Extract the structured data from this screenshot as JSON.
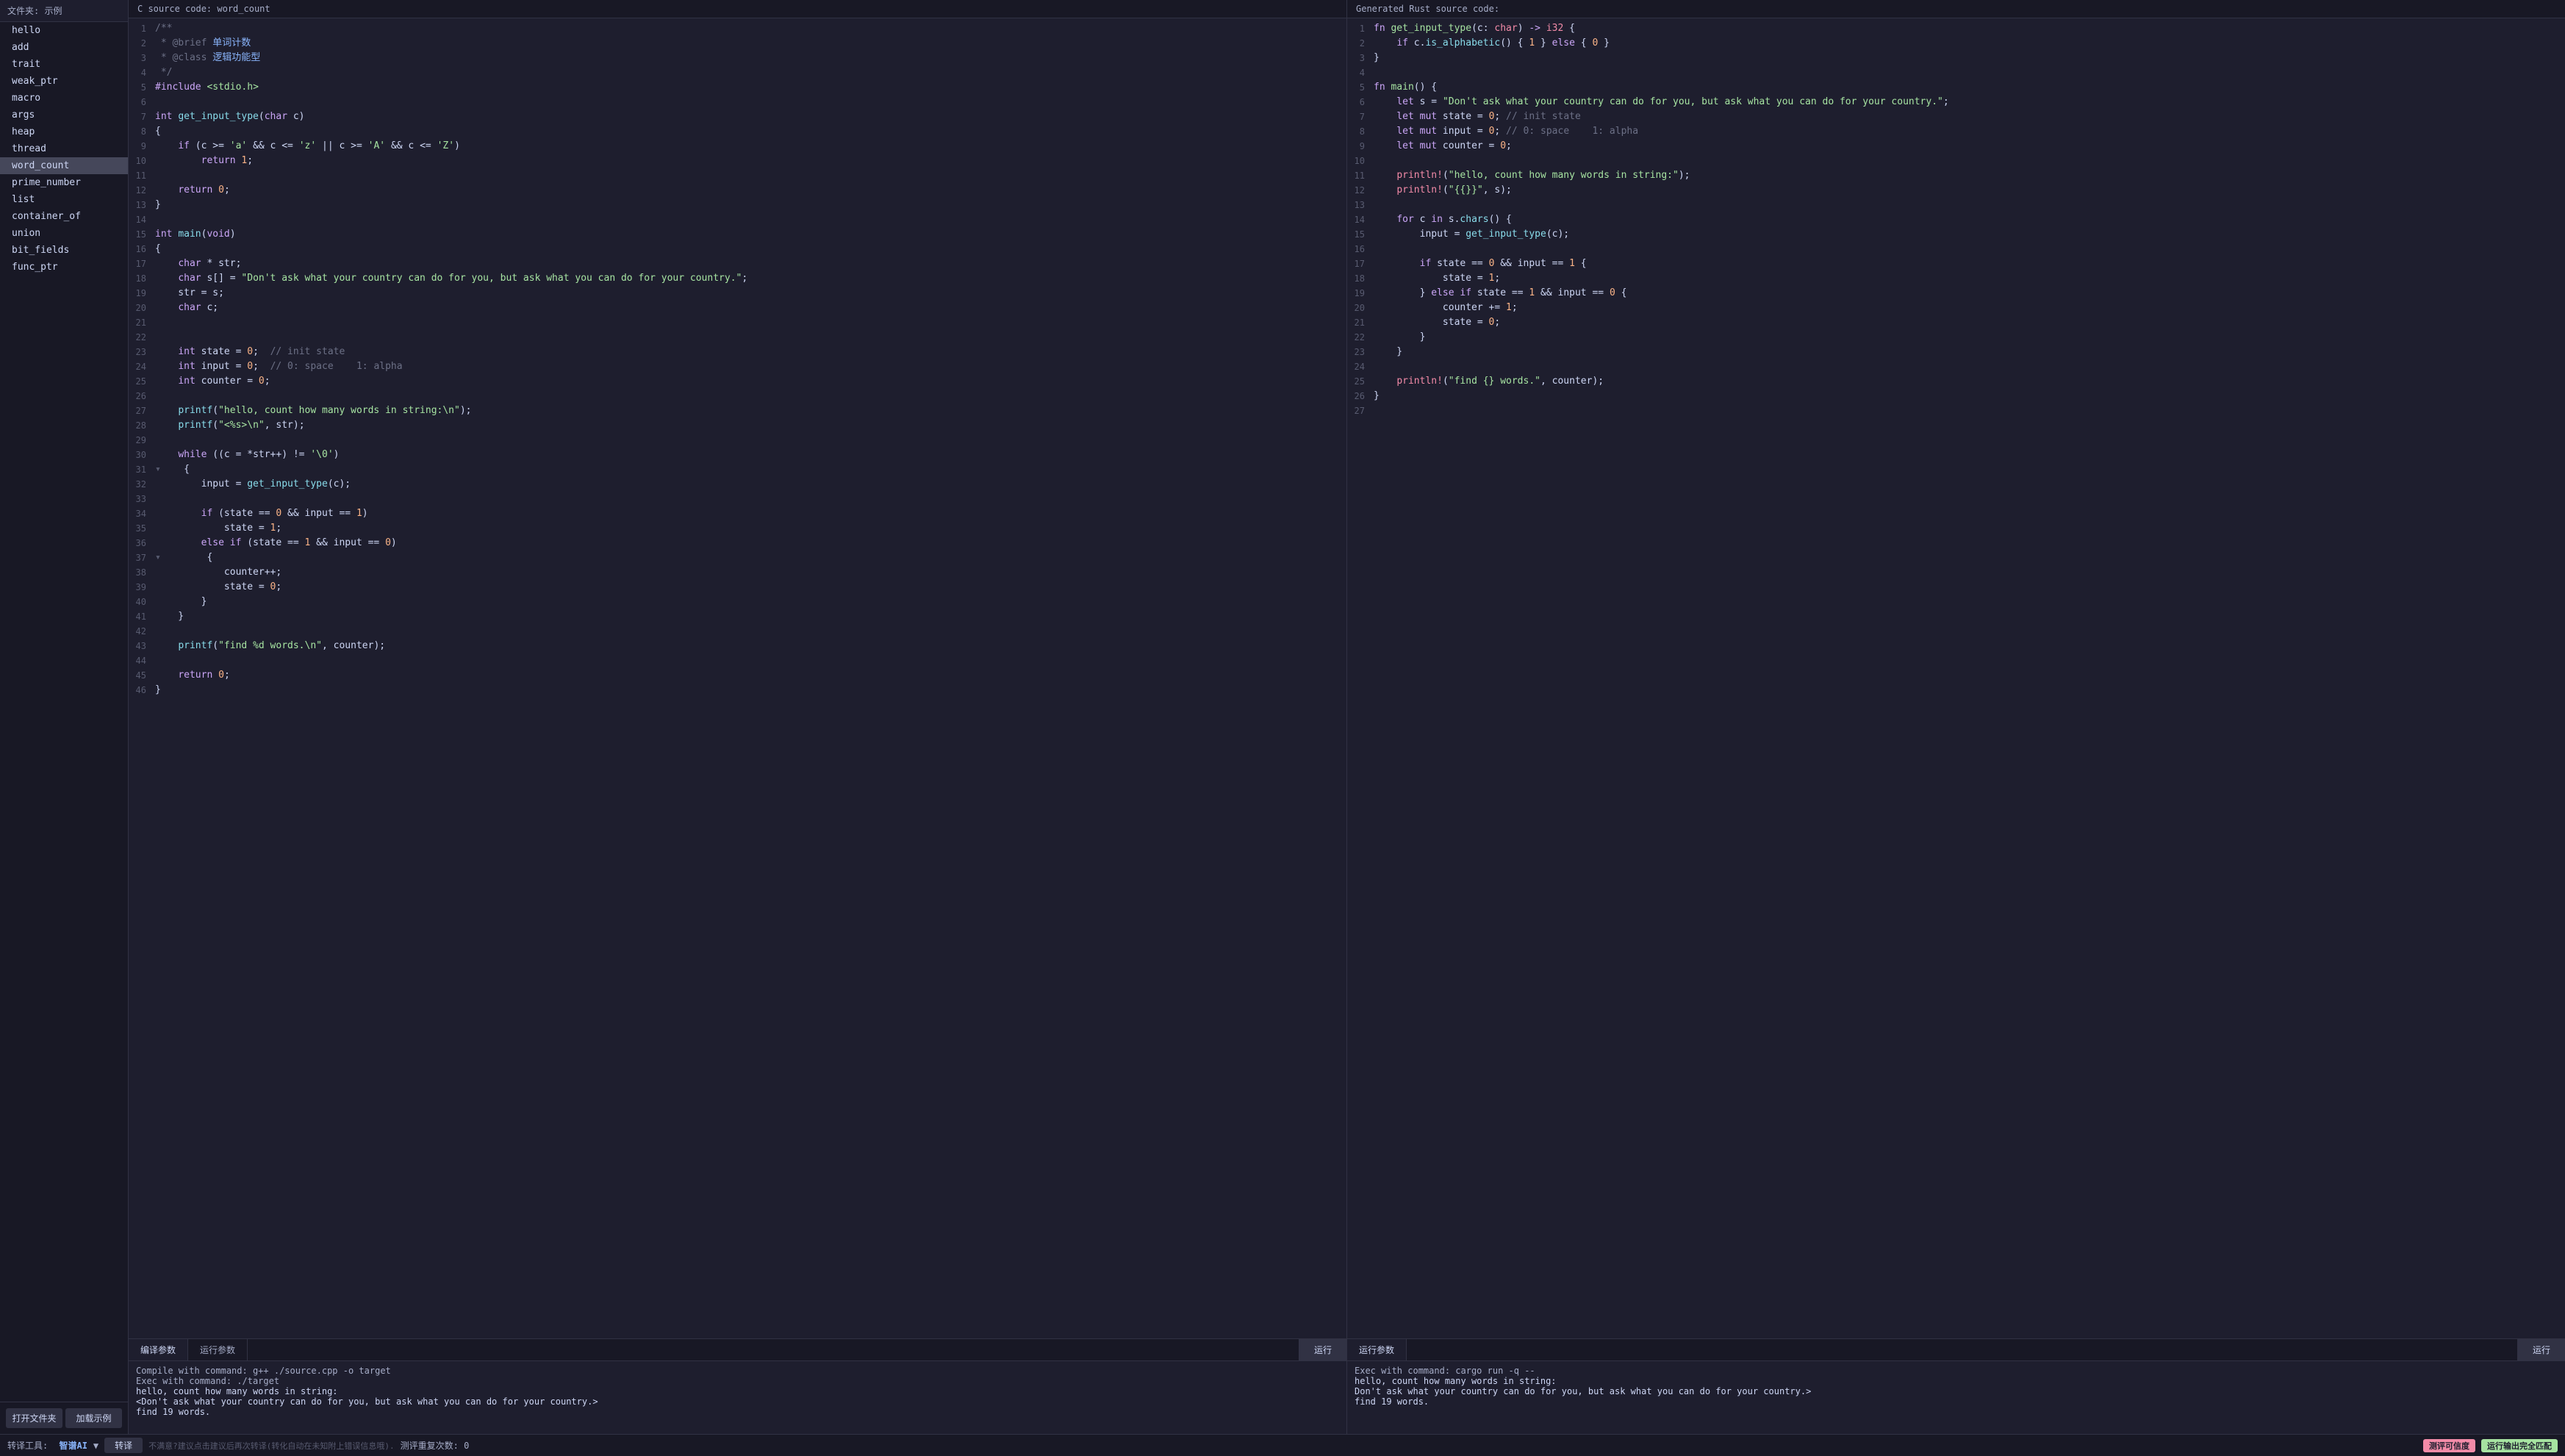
{
  "sidebar": {
    "title": "文件夹: 示例",
    "items": [
      {
        "label": "hello",
        "active": false
      },
      {
        "label": "add",
        "active": false
      },
      {
        "label": "trait",
        "active": false
      },
      {
        "label": "weak_ptr",
        "active": false
      },
      {
        "label": "macro",
        "active": false
      },
      {
        "label": "args",
        "active": false
      },
      {
        "label": "heap",
        "active": false
      },
      {
        "label": "thread",
        "active": false
      },
      {
        "label": "word_count",
        "active": true
      },
      {
        "label": "prime_number",
        "active": false
      },
      {
        "label": "list",
        "active": false
      },
      {
        "label": "container_of",
        "active": false
      },
      {
        "label": "union",
        "active": false
      },
      {
        "label": "bit_fields",
        "active": false
      },
      {
        "label": "func_ptr",
        "active": false
      }
    ],
    "open_button": "打开文件夹",
    "load_button": "加载示例"
  },
  "left_panel": {
    "header": "C source code: word_count"
  },
  "right_panel": {
    "header": "Generated Rust source code:"
  },
  "bottom_left": {
    "tab1": "编译参数",
    "tab2": "运行参数",
    "run_button": "运行",
    "content": "Compile with command: g++ ./source.cpp -o target\nExec with command: ./target\nhello, count how many words in string:\n<Don't ask what your country can do for you, but ask what you can do for your country.>\nfind 19 words."
  },
  "bottom_right": {
    "tab1": "运行参数",
    "run_button": "运行",
    "content": "Exec with command: cargo run -q --\nhello, count how many words in string:\nDon't ask what your country can do for you, but ask what you can do for your country.>\nfind 19 words."
  },
  "footer": {
    "tool_label": "转译工具:",
    "tool_name": "智谱AI",
    "translate_btn": "转译",
    "hint": "不满意?建议点击建议后再次转译(转化自动在未知附上错误信息哦).",
    "count_label": "测评重复次数: 0",
    "score_badge": "测评可信度",
    "match_badge": "运行输出完全匹配"
  }
}
